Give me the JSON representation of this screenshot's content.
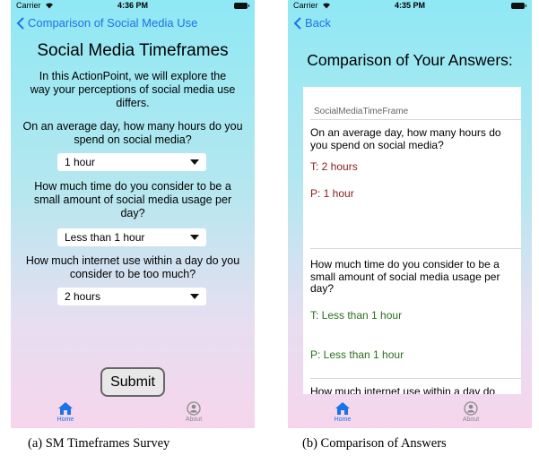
{
  "screen_a": {
    "status": {
      "carrier": "Carrier",
      "time": "4:36 PM"
    },
    "nav_back": "Comparison of Social Media Use",
    "title": "Social Media Timeframes",
    "intro": "In this ActionPoint, we will explore the way your perceptions of social media use differs.",
    "questions": [
      {
        "text": "On an average day, how many hours do you spend on social media?",
        "selected": "1 hour"
      },
      {
        "text": "How much time do you consider to be a small amount of social media usage per day?",
        "selected": "Less than 1 hour"
      },
      {
        "text": "How much internet use within a day do you consider to be too much?",
        "selected": "2 hours"
      }
    ],
    "submit_label": "Submit",
    "tabs": {
      "home": "Home",
      "about": "About"
    }
  },
  "screen_b": {
    "status": {
      "carrier": "Carrier",
      "time": "4:35 PM"
    },
    "nav_back": "Back",
    "title": "Comparison of Your Answers:",
    "section_header": "SocialMediaTimeFrame",
    "answers": [
      {
        "question": "On an average day, how many hours do you spend on social media?",
        "t": "T: 2 hours",
        "p": "P: 1 hour"
      },
      {
        "question": "How much time do you consider to be a small amount of social media usage per day?",
        "t": "T: Less than 1 hour",
        "p": "P: Less than 1 hour"
      },
      {
        "question": "How much internet use within a day do"
      }
    ],
    "tabs": {
      "home": "Home",
      "about": "About"
    }
  },
  "captions": {
    "a": "(a) SM Timeframes Survey",
    "b": "(b) Comparison of Answers"
  },
  "colors": {
    "accent": "#1a73e8",
    "teacher_answer": "#8b1a1a",
    "peer_answer": "#2a6f1e"
  }
}
